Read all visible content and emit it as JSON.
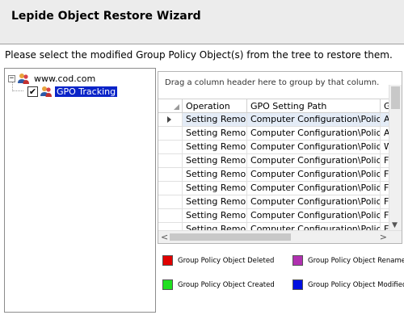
{
  "wizard": {
    "title": "Lepide Object Restore Wizard",
    "instruction": "Please select the modified Group Policy Object(s) from the tree to restore them."
  },
  "tree": {
    "root": {
      "label": "www.cod.com",
      "expander": "−",
      "icon": "domain-users-icon"
    },
    "child": {
      "label": "GPO Tracking",
      "checked": "✔",
      "icon": "gpo-users-icon"
    }
  },
  "grid": {
    "group_hint": "Drag a column header here to group by that column.",
    "columns": [
      "Operation",
      "GPO Setting Path",
      "G"
    ],
    "rows": [
      {
        "operation": "Setting Remo...",
        "path": "Computer Configuration\\Policies...",
        "g": "Ap"
      },
      {
        "operation": "Setting Remo...",
        "path": "Computer Configuration\\Policies...",
        "g": "Ap"
      },
      {
        "operation": "Setting Remo...",
        "path": "Computer Configuration\\Policies...",
        "g": "W"
      },
      {
        "operation": "Setting Remo...",
        "path": "Computer Configuration\\Policies...",
        "g": "Fi"
      },
      {
        "operation": "Setting Remo...",
        "path": "Computer Configuration\\Policies...",
        "g": "Fi"
      },
      {
        "operation": "Setting Remo...",
        "path": "Computer Configuration\\Policies...",
        "g": "Fi"
      },
      {
        "operation": "Setting Remo...",
        "path": "Computer Configuration\\Policies...",
        "g": "Fi"
      },
      {
        "operation": "Setting Remo...",
        "path": "Computer Configuration\\Policies...",
        "g": "Fi"
      },
      {
        "operation": "Setting Remo...",
        "path": "Computer Configuration\\Policies...",
        "g": "Fi"
      }
    ]
  },
  "legend": {
    "deleted": {
      "label": "Group Policy Object Deleted",
      "color": "#e00000"
    },
    "renamed": {
      "label": "Group Policy Object Renamed",
      "color": "#b030b0"
    },
    "created": {
      "label": "Group Policy Object Created",
      "color": "#20e020"
    },
    "modified": {
      "label": "Group Policy Object Modified",
      "color": "#0010e0"
    }
  }
}
